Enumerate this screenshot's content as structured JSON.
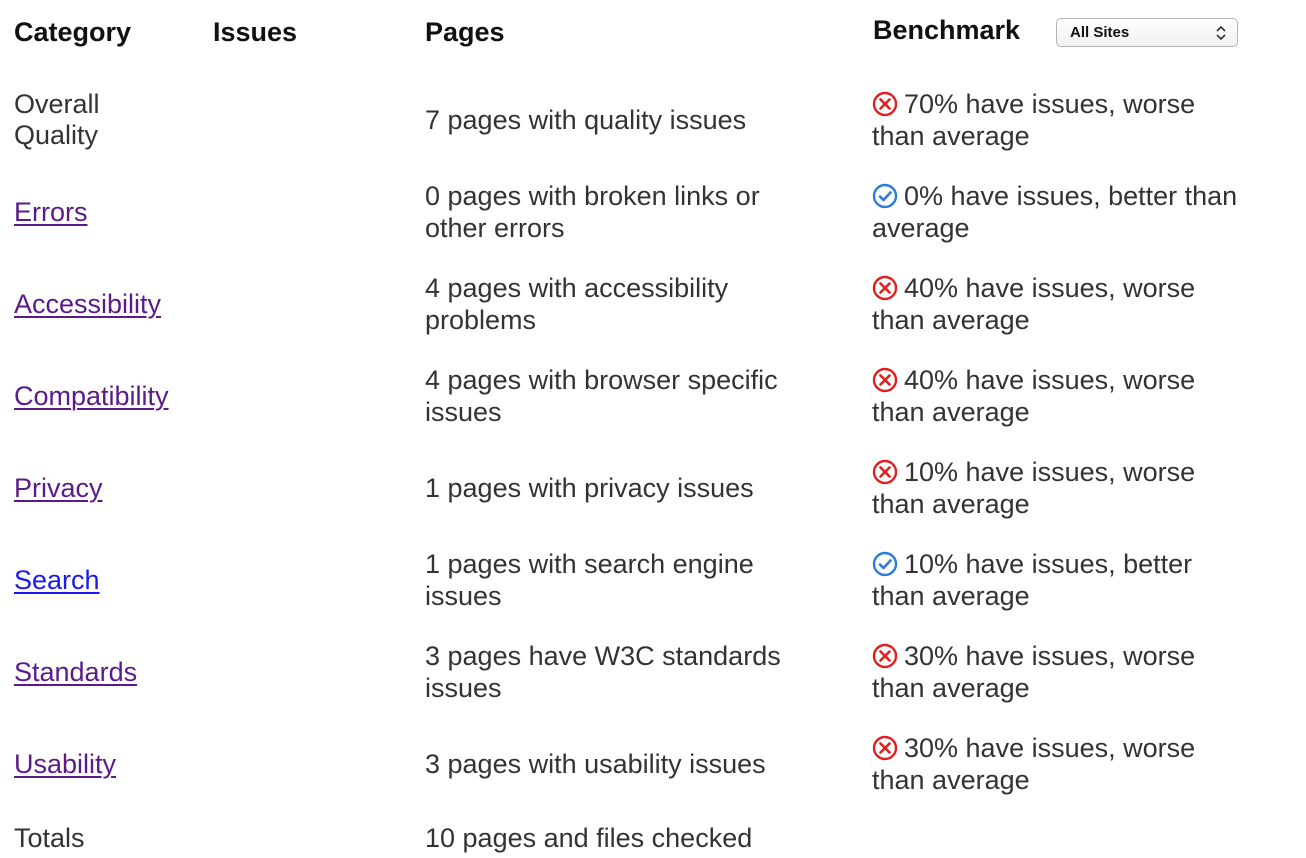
{
  "header": {
    "category": "Category",
    "issues": "Issues",
    "pages": "Pages",
    "benchmark": "Benchmark",
    "benchmark_select": "All Sites"
  },
  "colors": {
    "fail": "#e02020",
    "pass": "#2a7ae2",
    "link_visited": "#5a1a8a",
    "link_unvisited": "#1a1aee"
  },
  "rows": [
    {
      "category": "Overall\nQuality",
      "pages": "7 pages with quality issues",
      "status_icon": "fail-icon",
      "bench1": "70% have issues, worse",
      "bench2": "than average"
    },
    {
      "category": "Errors",
      "pages1": "0 pages with broken links or",
      "pages2": "other errors",
      "status_icon": "pass-icon",
      "bench1": "0% have issues, better than",
      "bench2": "average"
    },
    {
      "category": "Accessibility",
      "pages1": "4 pages with accessibility",
      "pages2": "problems",
      "status_icon": "fail-icon",
      "bench1": "40% have issues, worse",
      "bench2": "than average"
    },
    {
      "category": "Compatibility",
      "pages1": "4 pages with browser specific",
      "pages2": "issues",
      "status_icon": "fail-icon",
      "bench1": "40% have issues, worse",
      "bench2": "than average"
    },
    {
      "category": "Privacy",
      "pages": "1 pages with privacy issues",
      "status_icon": "fail-icon",
      "bench1": "10% have issues, worse",
      "bench2": "than average"
    },
    {
      "category": "Search",
      "pages1": "1 pages with search engine",
      "pages2": "issues",
      "status_icon": "pass-icon",
      "bench1": "10% have issues, better",
      "bench2": "than average"
    },
    {
      "category": "Standards",
      "pages1": "3 pages have W3C standards",
      "pages2": "issues",
      "status_icon": "fail-icon",
      "bench1": "30% have issues, worse",
      "bench2": "than average"
    },
    {
      "category": "Usability",
      "pages": "3 pages with usability issues",
      "status_icon": "fail-icon",
      "bench1": "30% have issues, worse",
      "bench2": "than average"
    }
  ],
  "totals": {
    "label": "Totals",
    "pages": "10 pages and files checked"
  }
}
